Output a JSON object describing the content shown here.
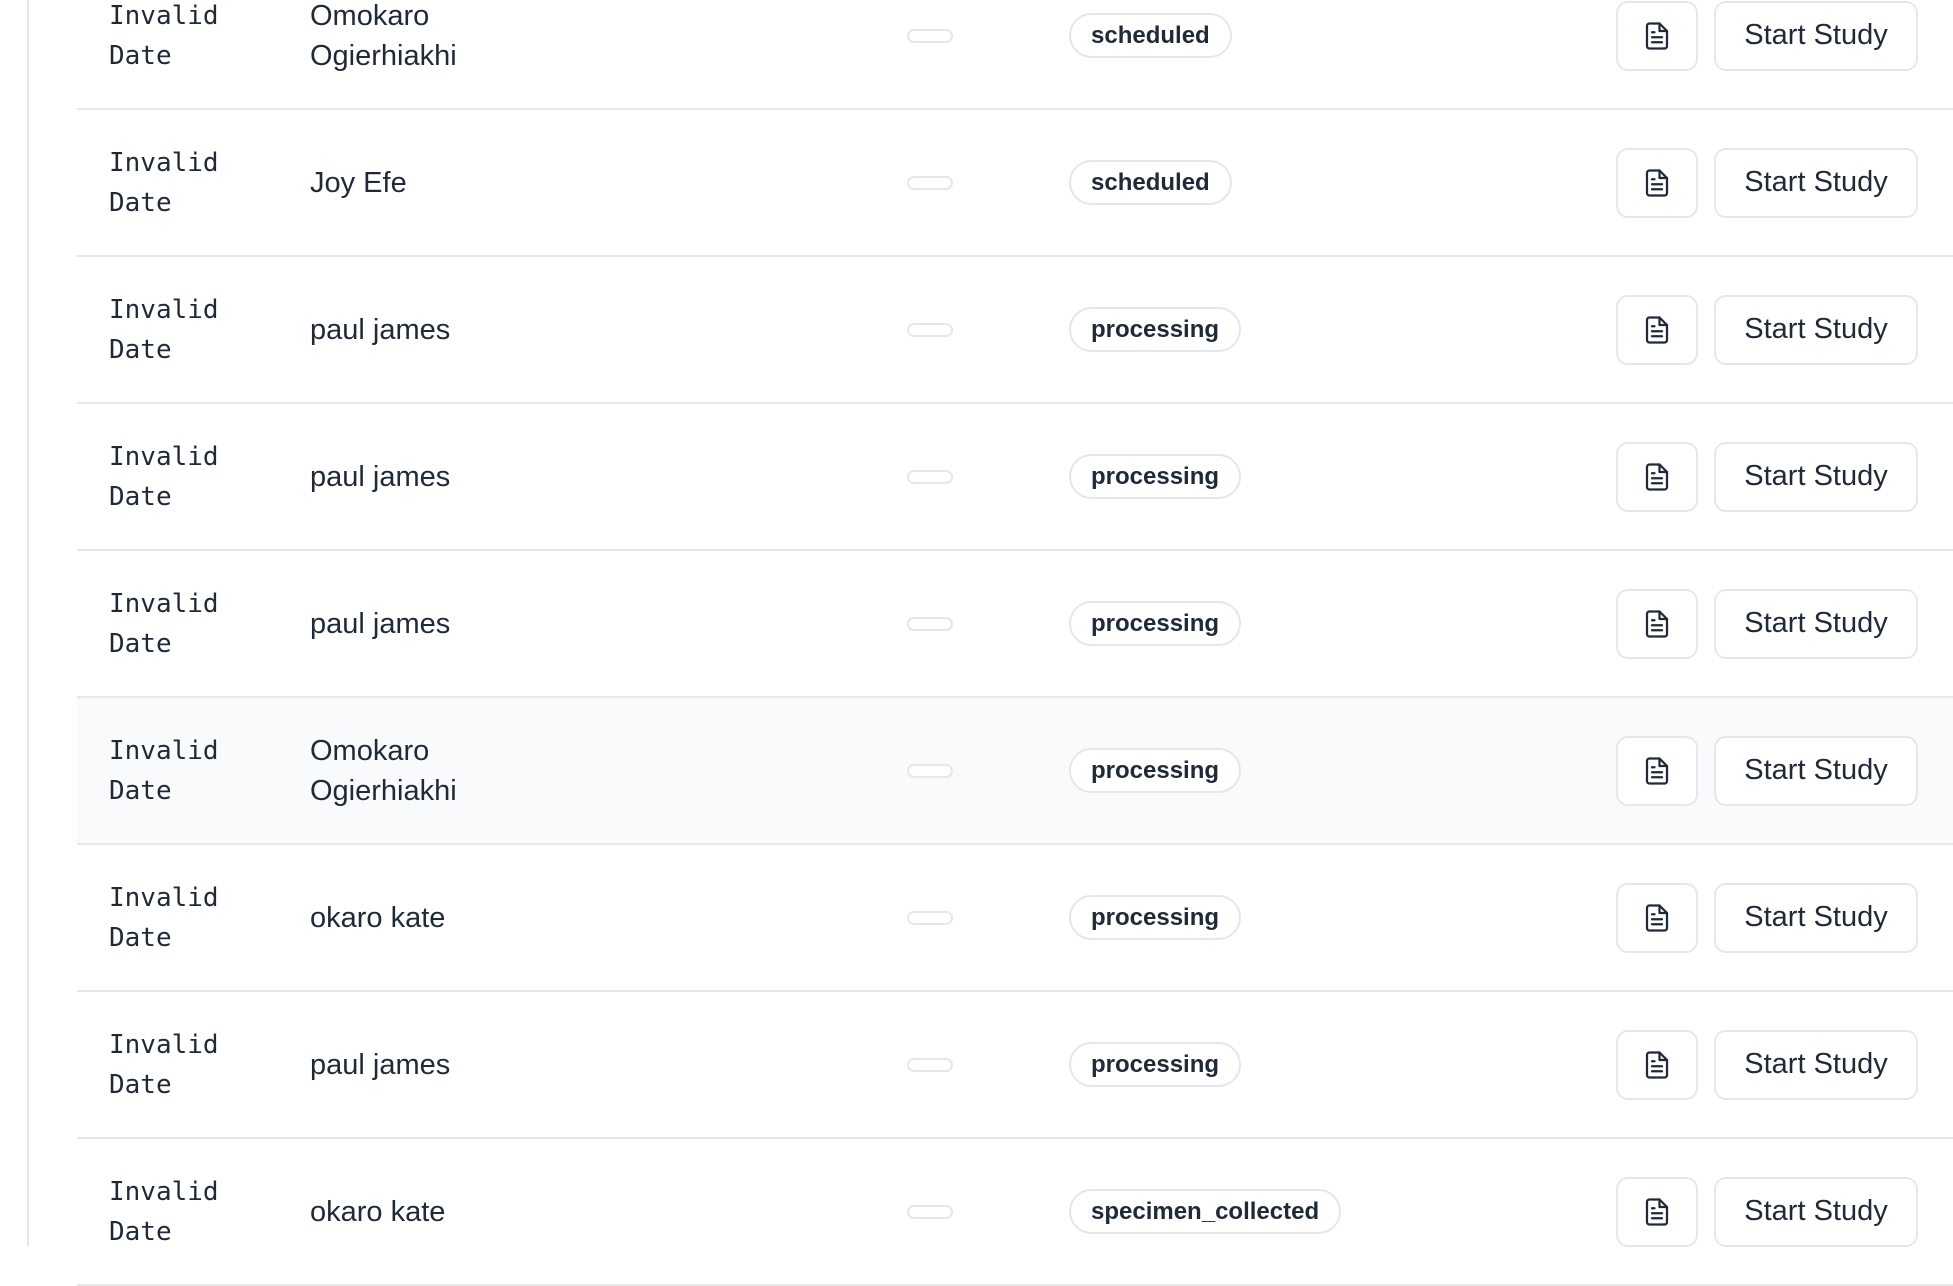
{
  "colors": {
    "border": "#e5e7eb",
    "text": "#1f2937",
    "highlight_row": "#f8fafc"
  },
  "icons": {
    "row_action": "document-icon"
  },
  "rows": [
    {
      "date_line1": "Invalid",
      "date_line2": "Date",
      "name_line1": "Omokaro",
      "name_line2": "Ogierhiakhi",
      "status": "scheduled",
      "action": "Start Study",
      "highlighted": false
    },
    {
      "date_line1": "Invalid",
      "date_line2": "Date",
      "name_line1": "Joy Efe",
      "name_line2": "",
      "status": "scheduled",
      "action": "Start Study",
      "highlighted": false
    },
    {
      "date_line1": "Invalid",
      "date_line2": "Date",
      "name_line1": "paul james",
      "name_line2": "",
      "status": "processing",
      "action": "Start Study",
      "highlighted": false
    },
    {
      "date_line1": "Invalid",
      "date_line2": "Date",
      "name_line1": "paul james",
      "name_line2": "",
      "status": "processing",
      "action": "Start Study",
      "highlighted": false
    },
    {
      "date_line1": "Invalid",
      "date_line2": "Date",
      "name_line1": "paul james",
      "name_line2": "",
      "status": "processing",
      "action": "Start Study",
      "highlighted": false
    },
    {
      "date_line1": "Invalid",
      "date_line2": "Date",
      "name_line1": "Omokaro",
      "name_line2": "Ogierhiakhi",
      "status": "processing",
      "action": "Start Study",
      "highlighted": true
    },
    {
      "date_line1": "Invalid",
      "date_line2": "Date",
      "name_line1": "okaro kate",
      "name_line2": "",
      "status": "processing",
      "action": "Start Study",
      "highlighted": false
    },
    {
      "date_line1": "Invalid",
      "date_line2": "Date",
      "name_line1": "paul james",
      "name_line2": "",
      "status": "processing",
      "action": "Start Study",
      "highlighted": false
    },
    {
      "date_line1": "Invalid",
      "date_line2": "Date",
      "name_line1": "okaro kate",
      "name_line2": "",
      "status": "specimen_collected",
      "action": "Start Study",
      "highlighted": false
    }
  ]
}
